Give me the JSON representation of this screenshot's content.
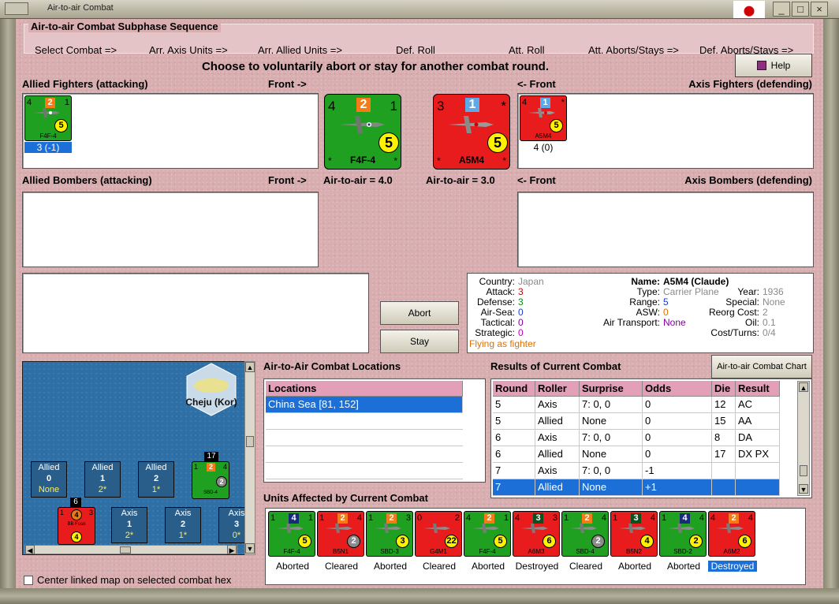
{
  "window": {
    "title": "Air-to-air Combat"
  },
  "sequence": {
    "title": "Air-to-air Combat Subphase Sequence",
    "steps": [
      "Select Combat =>",
      "Arr. Axis Units =>",
      "Arr. Allied Units =>",
      "Def. Roll",
      "Att. Roll",
      "Att. Aborts/Stays =>",
      "Def. Aborts/Stays =>"
    ]
  },
  "instruction": "Choose to voluntarily abort or stay for another combat round.",
  "help_label": "Help",
  "labels": {
    "allied_fighters": "Allied Fighters (attacking)",
    "front_right": "Front ->",
    "front_left": "<- Front",
    "axis_fighters": "Axis Fighters (defending)",
    "allied_bombers": "Allied Bombers (attacking)",
    "axis_bombers": "Axis Bombers (defending)",
    "allied_a2a": "Air-to-air = 4.0",
    "axis_a2a": "Air-to-air = 3.0"
  },
  "allied_fighter_unit": {
    "attack": "4",
    "badge": "2",
    "range": "1",
    "circle": "5",
    "name": "F4F-4",
    "bl": "*",
    "br": "*",
    "status": "3 (-1)"
  },
  "axis_fighter_unit": {
    "attack": "4",
    "badge": "1",
    "range": "*",
    "circle": "5",
    "name": "A5M4",
    "bl": "*",
    "br": "*",
    "status": "4 (0)"
  },
  "allied_big": {
    "attack": "4",
    "badge": "2",
    "range": "1",
    "circle": "5",
    "name": "F4F-4",
    "bl": "*",
    "br": "*"
  },
  "axis_big": {
    "attack": "3",
    "badge": "1",
    "range": "*",
    "circle": "5",
    "name": "A5M4",
    "bl": "*",
    "br": "*"
  },
  "buttons": {
    "abort": "Abort",
    "stay": "Stay",
    "chart": "Air-to-air Combat Chart"
  },
  "unit_info": {
    "country_label": "Country:",
    "country": "Japan",
    "attack_label": "Attack:",
    "attack": "3",
    "defense_label": "Defense:",
    "defense": "3",
    "airsea_label": "Air-Sea:",
    "airsea": "0",
    "tactical_label": "Tactical:",
    "tactical": "0",
    "strategic_label": "Strategic:",
    "strategic": "0",
    "flying": "Flying as fighter",
    "name_label": "Name:",
    "name": "A5M4 (Claude)",
    "type_label": "Type:",
    "type": "Carrier Plane",
    "year_label": "Year:",
    "year": "1936",
    "range_label": "Range:",
    "range": "5",
    "special_label": "Special:",
    "special": "None",
    "asw_label": "ASW:",
    "asw": "0",
    "reorg_label": "Reorg Cost:",
    "reorg": "2",
    "airtransport_label": "Air Transport:",
    "airtransport": "None",
    "oil_label": "Oil:",
    "oil": "0.1",
    "costturns_label": "Cost/Turns:",
    "costturns": "0/4",
    "colors": {
      "value_gray": "#8a8a8a",
      "attack_red": "#d00000",
      "defense_green": "#0a8a0a",
      "blue": "#1a3ad0",
      "magenta": "#c000c0",
      "orange": "#e07000",
      "purple": "#8000a0"
    }
  },
  "map": {
    "location_name": "Cheju (Kor)",
    "allied_boxes": [
      {
        "label": "Allied",
        "num": "0",
        "sub": "None"
      },
      {
        "label": "Allied",
        "num": "1",
        "sub": "2*"
      },
      {
        "label": "Allied",
        "num": "2",
        "sub": "1*"
      }
    ],
    "axis_boxes": [
      {
        "label": "Axis",
        "num": "1",
        "sub": "2*"
      },
      {
        "label": "Axis",
        "num": "2",
        "sub": "1*"
      },
      {
        "label": "Axis",
        "num": "3",
        "sub": "0*"
      }
    ],
    "stack_allied": {
      "count": "17",
      "badge": "2",
      "circle": "2",
      "tl": "1",
      "tr": "4",
      "name": "SBD-4"
    },
    "stack_axis": {
      "count": "6",
      "badge": "4",
      "circle": "4",
      "tl": "1",
      "tr": "3",
      "name": "BB Fuso"
    },
    "center_checkbox": "Center linked map on selected combat hex"
  },
  "locations": {
    "title": "Air-to-Air Combat Locations",
    "header": "Locations",
    "rows": [
      "China Sea [81, 152]"
    ]
  },
  "results": {
    "title": "Results of Current Combat",
    "headers": [
      "Round",
      "Roller",
      "Surprise",
      "Odds",
      "Die",
      "Result"
    ],
    "rows": [
      [
        "5",
        "Axis",
        "7: 0, 0",
        "0",
        "12",
        "AC"
      ],
      [
        "5",
        "Allied",
        "None",
        "0",
        "15",
        "AA"
      ],
      [
        "6",
        "Axis",
        "7: 0, 0",
        "0",
        "8",
        "DA"
      ],
      [
        "6",
        "Allied",
        "None",
        "0",
        "17",
        "DX PX"
      ],
      [
        "7",
        "Axis",
        "7: 0, 0",
        "-1",
        "",
        ""
      ],
      [
        "7",
        "Allied",
        "None",
        "+1",
        "",
        ""
      ]
    ]
  },
  "affected": {
    "title": "Units Affected by Current Combat",
    "units": [
      {
        "side": "green",
        "tl": "1",
        "badge": "4",
        "badge_color": "navy",
        "tr": "1",
        "circle": "5",
        "circle_color": "yellow",
        "name": "F4F-4",
        "status": "Aborted"
      },
      {
        "side": "red",
        "tl": "1",
        "badge": "2",
        "badge_color": "orange",
        "tr": "4",
        "circle": "2",
        "circle_color": "gray",
        "name": "B5N1",
        "status": "Cleared"
      },
      {
        "side": "green",
        "tl": "1",
        "badge": "2",
        "badge_color": "orange",
        "tr": "3",
        "circle": "3",
        "circle_color": "yellow",
        "name": "SBD-3",
        "status": "Aborted"
      },
      {
        "side": "red",
        "tl": "0",
        "badge": "",
        "badge_color": "orange",
        "tr": "2",
        "circle": "22",
        "circle_color": "yellow",
        "name": "G4M1",
        "status": "Cleared"
      },
      {
        "side": "green",
        "tl": "4",
        "badge": "2",
        "badge_color": "orange",
        "tr": "1",
        "circle": "5",
        "circle_color": "yellow",
        "name": "F4F-4",
        "status": "Aborted"
      },
      {
        "side": "red",
        "tl": "4",
        "badge": "3",
        "badge_color": "darkgreen",
        "tr": "3",
        "circle": "6",
        "circle_color": "yellow",
        "name": "A6M3",
        "status": "Destroyed"
      },
      {
        "side": "green",
        "tl": "1",
        "badge": "2",
        "badge_color": "orange",
        "tr": "4",
        "circle": "2",
        "circle_color": "gray",
        "name": "SBD-4",
        "status": "Cleared"
      },
      {
        "side": "red",
        "tl": "1",
        "badge": "3",
        "badge_color": "darkgreen",
        "tr": "4",
        "circle": "4",
        "circle_color": "yellow",
        "name": "B5N2",
        "status": "Aborted"
      },
      {
        "side": "green",
        "tl": "1",
        "badge": "4",
        "badge_color": "navy",
        "tr": "4",
        "circle": "2",
        "circle_color": "yellow",
        "name": "SBD-2",
        "status": "Aborted"
      },
      {
        "side": "red",
        "tl": "4",
        "badge": "2",
        "badge_color": "orange",
        "tr": "4",
        "circle": "6",
        "circle_color": "yellow",
        "name": "A6M2",
        "status": "Destroyed"
      }
    ]
  }
}
